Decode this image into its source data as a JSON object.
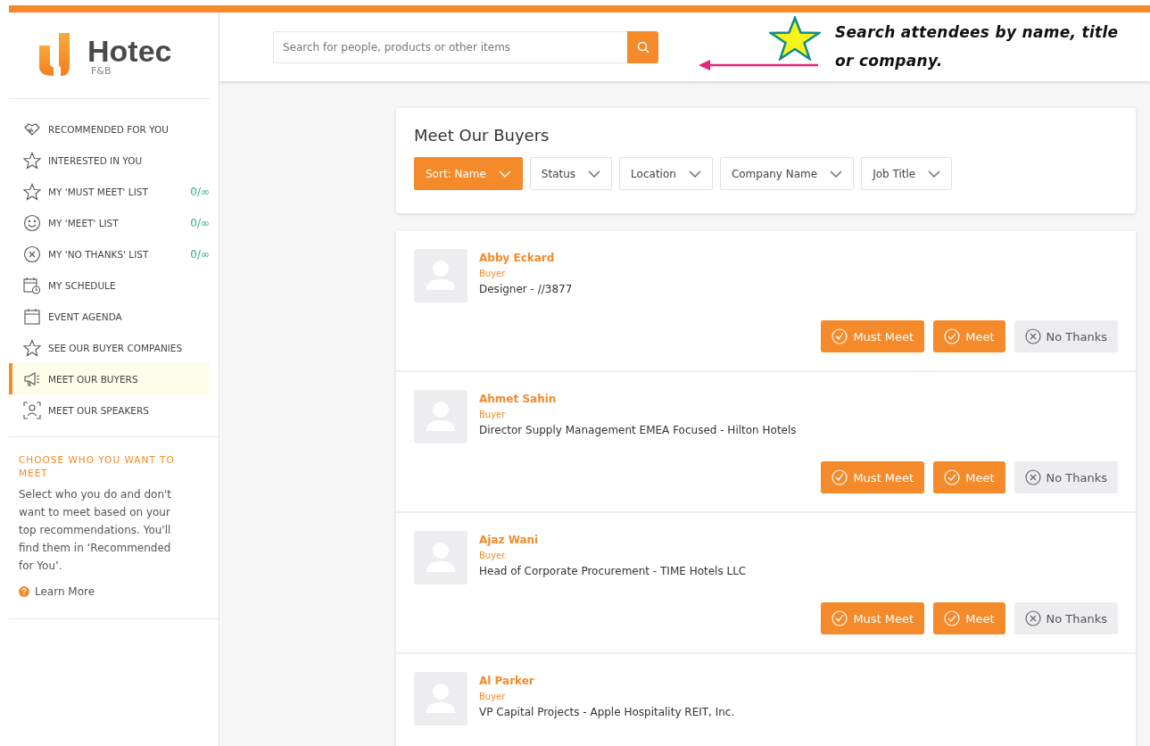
{
  "logo": {
    "name": "Hotec",
    "sub": "F&B"
  },
  "sidebar": {
    "items": [
      {
        "kind": "handshake",
        "label": "RECOMMENDED FOR YOU",
        "selected": false
      },
      {
        "kind": "star",
        "label": "INTERESTED IN YOU",
        "selected": false
      },
      {
        "kind": "star",
        "label": "MY 'MUST MEET' LIST",
        "count": "0/∞",
        "selected": false
      },
      {
        "kind": "smiley",
        "label": "MY 'MEET' LIST",
        "count": "0/∞",
        "selected": false
      },
      {
        "kind": "x-circle",
        "label": "MY 'NO THANKS' LIST",
        "count": "0/∞",
        "selected": false
      },
      {
        "kind": "schedule",
        "label": "MY SCHEDULE",
        "selected": false
      },
      {
        "kind": "calendar",
        "label": "EVENT AGENDA",
        "selected": false
      },
      {
        "kind": "star",
        "label": "SEE OUR BUYER COMPANIES",
        "selected": false
      },
      {
        "kind": "megaphone",
        "label": "MEET OUR BUYERS",
        "selected": true
      },
      {
        "kind": "person",
        "label": "MEET OUR SPEAKERS",
        "selected": false
      }
    ],
    "help": {
      "title": "CHOOSE WHO YOU WANT TO MEET",
      "text": "Select who you do and don't want to meet based on your top recommendations. You'll find them in ‘Recommended for You’.",
      "link": "Learn More"
    }
  },
  "search": {
    "placeholder": "Search for people, products or other items"
  },
  "annotation": {
    "text": "Search attendees by name, title or company."
  },
  "page": {
    "title": "Meet Our Buyers",
    "filters": [
      {
        "label": "Sort: Name",
        "selected": true
      },
      {
        "label": "Status",
        "selected": false
      },
      {
        "label": "Location",
        "selected": false
      },
      {
        "label": "Company Name",
        "selected": false
      },
      {
        "label": "Job Title",
        "selected": false
      }
    ]
  },
  "buyers": [
    {
      "name": "Abby Eckard",
      "role": "Buyer",
      "title": "Designer - //3877",
      "actions": [
        {
          "kind": "must",
          "label": "Must Meet"
        },
        {
          "kind": "meet",
          "label": "Meet"
        },
        {
          "kind": "no",
          "label": "No Thanks"
        }
      ]
    },
    {
      "name": "Ahmet Sahin",
      "role": "Buyer",
      "title": "Director Supply Management EMEA Focused - Hilton Hotels",
      "actions": [
        {
          "kind": "must",
          "label": "Must Meet"
        },
        {
          "kind": "meet",
          "label": "Meet"
        },
        {
          "kind": "no",
          "label": "No Thanks"
        }
      ]
    },
    {
      "name": "Ajaz Wani",
      "role": "Buyer",
      "title": "Head of Corporate Procurement - TIME Hotels LLC",
      "actions": [
        {
          "kind": "must",
          "label": "Must Meet"
        },
        {
          "kind": "meet",
          "label": "Meet"
        },
        {
          "kind": "no",
          "label": "No Thanks"
        }
      ]
    },
    {
      "name": "Al Parker",
      "role": "Buyer",
      "title": "VP Capital Projects - Apple Hospitality REIT, Inc."
    }
  ]
}
